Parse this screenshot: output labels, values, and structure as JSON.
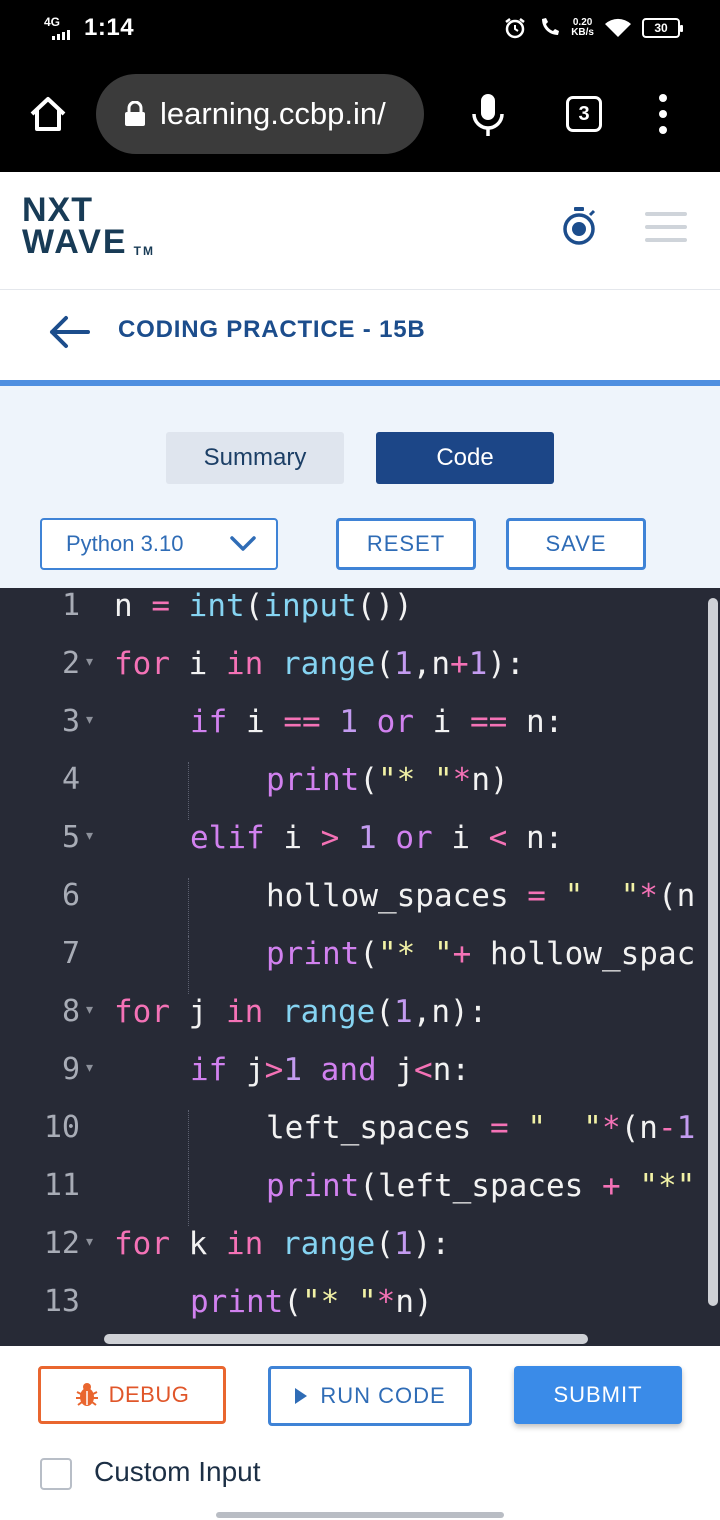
{
  "status_bar": {
    "network": "4G",
    "time": "1:14",
    "speed_value": "0.20",
    "speed_unit": "KB/s",
    "battery": "30"
  },
  "browser": {
    "url": "learning.ccbp.in/",
    "tab_count": "3"
  },
  "header": {
    "logo_line1": "NXT",
    "logo_line2": "WAVE",
    "logo_tm": "TM"
  },
  "page": {
    "title": "CODING PRACTICE - 15B"
  },
  "tabs": {
    "summary": "Summary",
    "code": "Code"
  },
  "toolbar": {
    "language": "Python 3.10",
    "reset": "RESET",
    "save": "SAVE"
  },
  "editor": {
    "lines": [
      {
        "num": "1",
        "fold": false
      },
      {
        "num": "2",
        "fold": true
      },
      {
        "num": "3",
        "fold": true
      },
      {
        "num": "4",
        "fold": false
      },
      {
        "num": "5",
        "fold": true
      },
      {
        "num": "6",
        "fold": false
      },
      {
        "num": "7",
        "fold": false
      },
      {
        "num": "8",
        "fold": true
      },
      {
        "num": "9",
        "fold": true
      },
      {
        "num": "10",
        "fold": false
      },
      {
        "num": "11",
        "fold": false
      },
      {
        "num": "12",
        "fold": true
      },
      {
        "num": "13",
        "fold": false
      }
    ],
    "tokens": {
      "l1": [
        "n ",
        "=",
        " ",
        "int",
        "(",
        "input",
        "())"
      ],
      "l2": [
        "for",
        " i ",
        "in",
        " ",
        "range",
        "(",
        "1",
        ",n",
        "+",
        "1",
        "):"
      ],
      "l3": [
        "if",
        " i ",
        "==",
        " ",
        "1",
        " ",
        "or",
        " i ",
        "==",
        " n:"
      ],
      "l4": [
        "print",
        "(",
        "\"* \"",
        "*",
        "n)"
      ],
      "l5": [
        "elif",
        " i ",
        ">",
        " ",
        "1",
        " ",
        "or",
        " i ",
        "<",
        " n:"
      ],
      "l6": [
        "hollow_spaces ",
        "=",
        " ",
        "\"  \"",
        "*",
        "(n"
      ],
      "l7": [
        "print",
        "(",
        "\"* \"",
        "+",
        " hollow_spac"
      ],
      "l8": [
        "for",
        " j ",
        "in",
        " ",
        "range",
        "(",
        "1",
        ",n):"
      ],
      "l9": [
        "if",
        " j",
        ">",
        "1",
        " ",
        "and",
        " j",
        "<",
        "n:"
      ],
      "l10": [
        "left_spaces ",
        "=",
        " ",
        "\"  \"",
        "*",
        "(n",
        "-",
        "1"
      ],
      "l11": [
        "print",
        "(left_spaces ",
        "+",
        " ",
        "\"*\""
      ],
      "l12": [
        "for",
        " k ",
        "in",
        " ",
        "range",
        "(",
        "1",
        "):"
      ],
      "l13": [
        "print",
        "(",
        "\"* \"",
        "*",
        "n)"
      ]
    }
  },
  "actions": {
    "debug": "DEBUG",
    "run": "RUN CODE",
    "submit": "SUBMIT"
  },
  "custom_input": {
    "label": "Custom Input",
    "checked": false
  },
  "colors": {
    "brand_blue": "#1c4687",
    "accent_blue": "#3a8be8",
    "debug_orange": "#e9662f",
    "editor_bg": "#272a36"
  }
}
